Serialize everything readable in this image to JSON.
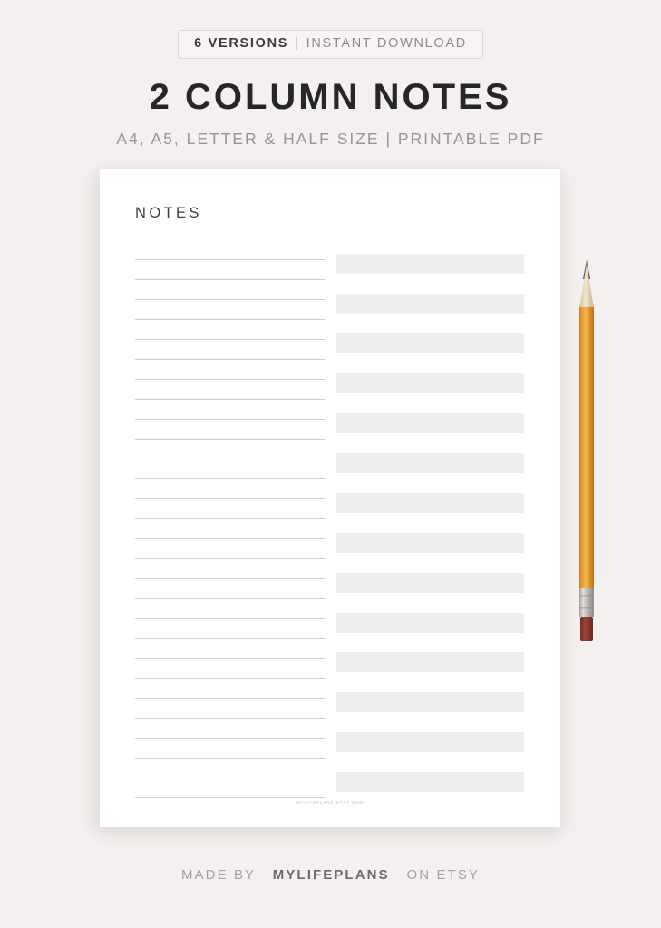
{
  "page": {
    "background_color": "#f4f0ef",
    "sheet_color": "#ffffff"
  },
  "header": {
    "badge": {
      "versions_label": "6 VERSIONS",
      "separator": "|",
      "download_label": "INSTANT DOWNLOAD",
      "border_color": "#dcd8d7"
    },
    "title": "2 COLUMN NOTES",
    "subtitle": "A4, A5, LETTER & HALF SIZE | PRINTABLE PDF",
    "title_color": "#262626",
    "subtitle_color": "#9a9594"
  },
  "sheet": {
    "heading": "NOTES",
    "watermark": "MYLIFEPLANS.ETSY.COM",
    "left_column": {
      "type": "ruled-lines",
      "line_count": 28,
      "line_color": "#cfcfcf"
    },
    "right_column": {
      "type": "filled-bars",
      "bar_count": 14,
      "bar_color": "#ededed"
    }
  },
  "pencil": {
    "barrel_color": "#e8a33a",
    "wood_color": "#e8d7b4",
    "graphite_color": "#6b6b6b",
    "ferrule_color": "#c9c7c4",
    "eraser_color": "#8c3b30"
  },
  "footer": {
    "prefix": "MADE BY",
    "brand": "MYLIFEPLANS",
    "suffix": "ON ETSY"
  }
}
